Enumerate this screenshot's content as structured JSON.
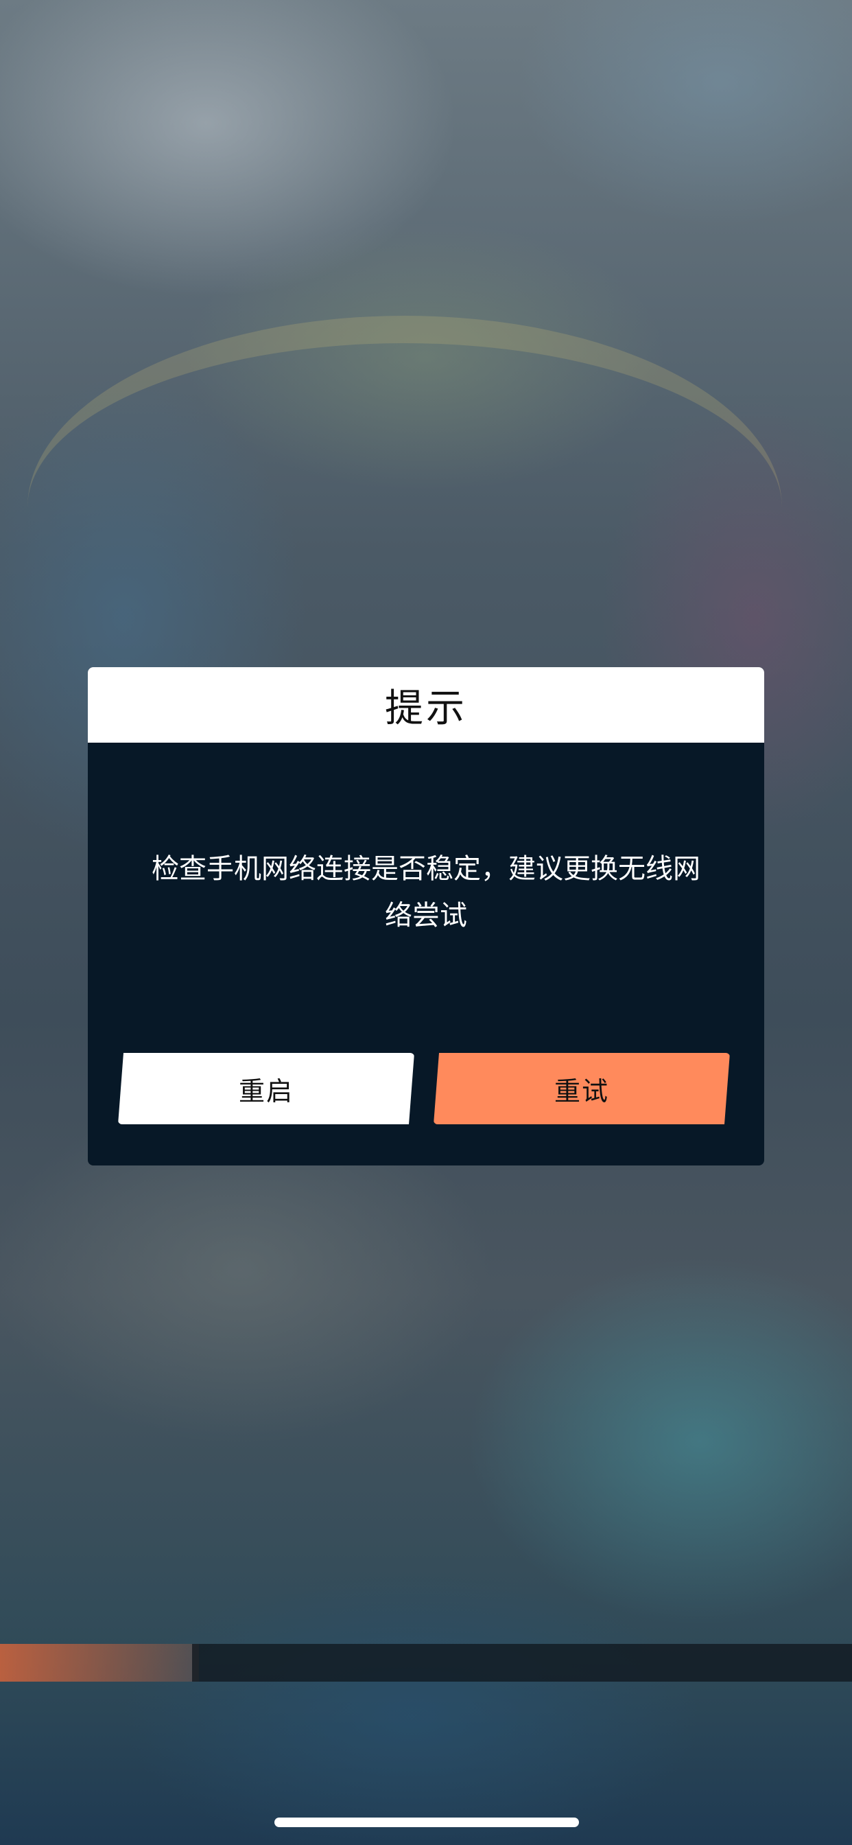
{
  "dialog": {
    "title": "提示",
    "message": "检查手机网络连接是否稳定，建议更换无线网络尝试",
    "buttons": {
      "restart": "重启",
      "retry": "重试"
    }
  },
  "colors": {
    "dialog_body": "#071827",
    "header_bg": "#ffffff",
    "retry_accent": "#ff8a5c"
  }
}
